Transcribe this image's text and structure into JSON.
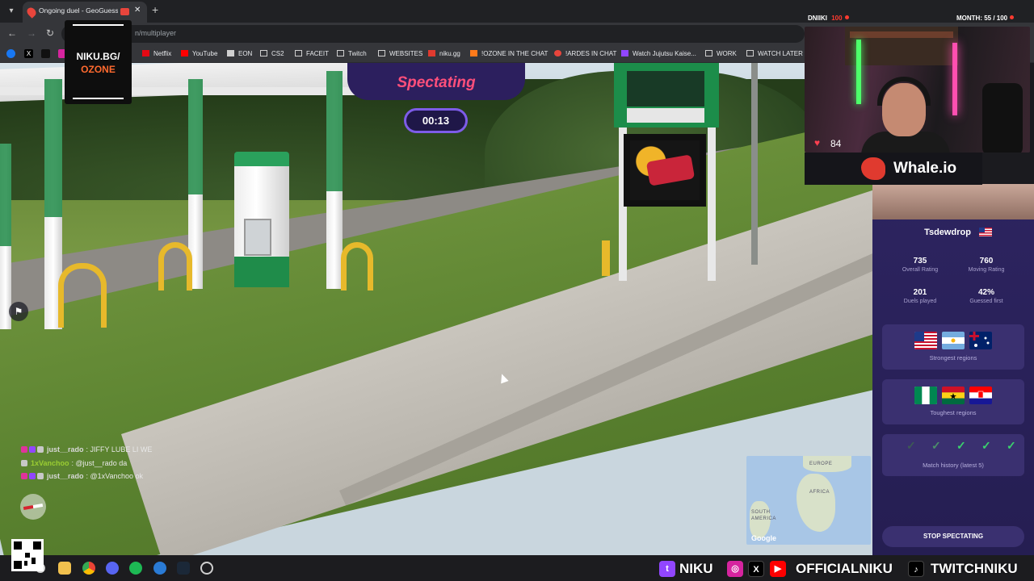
{
  "browser": {
    "tab_title": "Ongoing duel - GeoGuessr",
    "url": "n/multiplayer",
    "bookmarks": [
      "Netflix",
      "YouTube",
      "EON",
      "CS2",
      "FACEIT",
      "Twitch",
      "WEBSITES",
      "niku.gg",
      "!OZONE IN THE CHAT",
      "!ARDES IN CHAT",
      "Watch Jujutsu Kaise...",
      "WORK",
      "WATCH LATER"
    ]
  },
  "game": {
    "status": "Spectating",
    "timer": "00:13",
    "minimap": {
      "labels": [
        "EUROPE",
        "AFRICA",
        "SOUTH AMERICA"
      ],
      "provider": "Google"
    }
  },
  "player": {
    "name": "Tsdewdrop",
    "stats": [
      {
        "value": "735",
        "label": "Overall Rating"
      },
      {
        "value": "760",
        "label": "Moving Rating"
      },
      {
        "value": "201",
        "label": "Duels played"
      },
      {
        "value": "42%",
        "label": "Guessed first"
      }
    ],
    "strongest_label": "Strongest regions",
    "toughest_label": "Toughest regions",
    "history_label": "Match history (latest 5)",
    "stop_label": "STOP SPECTATING"
  },
  "stream": {
    "logo_line1": "NIKU.BG/",
    "logo_line2": "OZONE",
    "overlay_left": "DNIIKI",
    "overlay_left_value": "100",
    "overlay_right": "MONTH: 55 / 100",
    "heart_rate": "84",
    "sponsor": "Whale.io",
    "socials": [
      "NIKU",
      "OFFICIALNIKU",
      "TWITCHNIKU"
    ]
  },
  "chat": [
    {
      "user": "just__rado",
      "color": "#d8d8d8",
      "message": ": JIFFY LUBE LI WE"
    },
    {
      "user": "1xVanchoo",
      "color": "#9acd32",
      "message": ": @just__rado da"
    },
    {
      "user": "just__rado",
      "color": "#d8d8d8",
      "message": ": @1xVanchoo ok"
    }
  ],
  "colors": {
    "accent": "#ff4f7b",
    "panel": "#2d2460",
    "timer_border": "#7d5ce8",
    "check": "#3ad16d"
  }
}
